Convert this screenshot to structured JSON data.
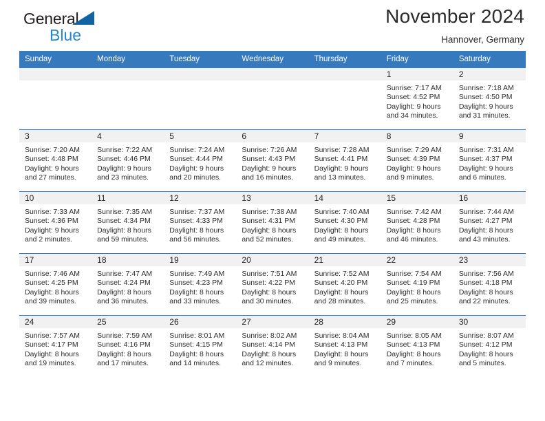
{
  "brand": {
    "name_part1": "General",
    "name_part2": "Blue",
    "triangle_color": "#1263a4",
    "blue_text_color": "#2288d4"
  },
  "header": {
    "title": "November 2024",
    "subtitle": "Hannover, Germany"
  },
  "theme": {
    "header_bg": "#3679bd",
    "daynum_band_bg": "#f1f1f1",
    "row_border": "#3679bd",
    "text": "#2b2b2b"
  },
  "weekdays": [
    "Sunday",
    "Monday",
    "Tuesday",
    "Wednesday",
    "Thursday",
    "Friday",
    "Saturday"
  ],
  "weeks": [
    [
      {
        "day": "",
        "sunrise": "",
        "sunset": "",
        "daylight_line1": "",
        "daylight_line2": ""
      },
      {
        "day": "",
        "sunrise": "",
        "sunset": "",
        "daylight_line1": "",
        "daylight_line2": ""
      },
      {
        "day": "",
        "sunrise": "",
        "sunset": "",
        "daylight_line1": "",
        "daylight_line2": ""
      },
      {
        "day": "",
        "sunrise": "",
        "sunset": "",
        "daylight_line1": "",
        "daylight_line2": ""
      },
      {
        "day": "",
        "sunrise": "",
        "sunset": "",
        "daylight_line1": "",
        "daylight_line2": ""
      },
      {
        "day": "1",
        "sunrise": "Sunrise: 7:17 AM",
        "sunset": "Sunset: 4:52 PM",
        "daylight_line1": "Daylight: 9 hours",
        "daylight_line2": "and 34 minutes."
      },
      {
        "day": "2",
        "sunrise": "Sunrise: 7:18 AM",
        "sunset": "Sunset: 4:50 PM",
        "daylight_line1": "Daylight: 9 hours",
        "daylight_line2": "and 31 minutes."
      }
    ],
    [
      {
        "day": "3",
        "sunrise": "Sunrise: 7:20 AM",
        "sunset": "Sunset: 4:48 PM",
        "daylight_line1": "Daylight: 9 hours",
        "daylight_line2": "and 27 minutes."
      },
      {
        "day": "4",
        "sunrise": "Sunrise: 7:22 AM",
        "sunset": "Sunset: 4:46 PM",
        "daylight_line1": "Daylight: 9 hours",
        "daylight_line2": "and 23 minutes."
      },
      {
        "day": "5",
        "sunrise": "Sunrise: 7:24 AM",
        "sunset": "Sunset: 4:44 PM",
        "daylight_line1": "Daylight: 9 hours",
        "daylight_line2": "and 20 minutes."
      },
      {
        "day": "6",
        "sunrise": "Sunrise: 7:26 AM",
        "sunset": "Sunset: 4:43 PM",
        "daylight_line1": "Daylight: 9 hours",
        "daylight_line2": "and 16 minutes."
      },
      {
        "day": "7",
        "sunrise": "Sunrise: 7:28 AM",
        "sunset": "Sunset: 4:41 PM",
        "daylight_line1": "Daylight: 9 hours",
        "daylight_line2": "and 13 minutes."
      },
      {
        "day": "8",
        "sunrise": "Sunrise: 7:29 AM",
        "sunset": "Sunset: 4:39 PM",
        "daylight_line1": "Daylight: 9 hours",
        "daylight_line2": "and 9 minutes."
      },
      {
        "day": "9",
        "sunrise": "Sunrise: 7:31 AM",
        "sunset": "Sunset: 4:37 PM",
        "daylight_line1": "Daylight: 9 hours",
        "daylight_line2": "and 6 minutes."
      }
    ],
    [
      {
        "day": "10",
        "sunrise": "Sunrise: 7:33 AM",
        "sunset": "Sunset: 4:36 PM",
        "daylight_line1": "Daylight: 9 hours",
        "daylight_line2": "and 2 minutes."
      },
      {
        "day": "11",
        "sunrise": "Sunrise: 7:35 AM",
        "sunset": "Sunset: 4:34 PM",
        "daylight_line1": "Daylight: 8 hours",
        "daylight_line2": "and 59 minutes."
      },
      {
        "day": "12",
        "sunrise": "Sunrise: 7:37 AM",
        "sunset": "Sunset: 4:33 PM",
        "daylight_line1": "Daylight: 8 hours",
        "daylight_line2": "and 56 minutes."
      },
      {
        "day": "13",
        "sunrise": "Sunrise: 7:38 AM",
        "sunset": "Sunset: 4:31 PM",
        "daylight_line1": "Daylight: 8 hours",
        "daylight_line2": "and 52 minutes."
      },
      {
        "day": "14",
        "sunrise": "Sunrise: 7:40 AM",
        "sunset": "Sunset: 4:30 PM",
        "daylight_line1": "Daylight: 8 hours",
        "daylight_line2": "and 49 minutes."
      },
      {
        "day": "15",
        "sunrise": "Sunrise: 7:42 AM",
        "sunset": "Sunset: 4:28 PM",
        "daylight_line1": "Daylight: 8 hours",
        "daylight_line2": "and 46 minutes."
      },
      {
        "day": "16",
        "sunrise": "Sunrise: 7:44 AM",
        "sunset": "Sunset: 4:27 PM",
        "daylight_line1": "Daylight: 8 hours",
        "daylight_line2": "and 43 minutes."
      }
    ],
    [
      {
        "day": "17",
        "sunrise": "Sunrise: 7:46 AM",
        "sunset": "Sunset: 4:25 PM",
        "daylight_line1": "Daylight: 8 hours",
        "daylight_line2": "and 39 minutes."
      },
      {
        "day": "18",
        "sunrise": "Sunrise: 7:47 AM",
        "sunset": "Sunset: 4:24 PM",
        "daylight_line1": "Daylight: 8 hours",
        "daylight_line2": "and 36 minutes."
      },
      {
        "day": "19",
        "sunrise": "Sunrise: 7:49 AM",
        "sunset": "Sunset: 4:23 PM",
        "daylight_line1": "Daylight: 8 hours",
        "daylight_line2": "and 33 minutes."
      },
      {
        "day": "20",
        "sunrise": "Sunrise: 7:51 AM",
        "sunset": "Sunset: 4:22 PM",
        "daylight_line1": "Daylight: 8 hours",
        "daylight_line2": "and 30 minutes."
      },
      {
        "day": "21",
        "sunrise": "Sunrise: 7:52 AM",
        "sunset": "Sunset: 4:20 PM",
        "daylight_line1": "Daylight: 8 hours",
        "daylight_line2": "and 28 minutes."
      },
      {
        "day": "22",
        "sunrise": "Sunrise: 7:54 AM",
        "sunset": "Sunset: 4:19 PM",
        "daylight_line1": "Daylight: 8 hours",
        "daylight_line2": "and 25 minutes."
      },
      {
        "day": "23",
        "sunrise": "Sunrise: 7:56 AM",
        "sunset": "Sunset: 4:18 PM",
        "daylight_line1": "Daylight: 8 hours",
        "daylight_line2": "and 22 minutes."
      }
    ],
    [
      {
        "day": "24",
        "sunrise": "Sunrise: 7:57 AM",
        "sunset": "Sunset: 4:17 PM",
        "daylight_line1": "Daylight: 8 hours",
        "daylight_line2": "and 19 minutes."
      },
      {
        "day": "25",
        "sunrise": "Sunrise: 7:59 AM",
        "sunset": "Sunset: 4:16 PM",
        "daylight_line1": "Daylight: 8 hours",
        "daylight_line2": "and 17 minutes."
      },
      {
        "day": "26",
        "sunrise": "Sunrise: 8:01 AM",
        "sunset": "Sunset: 4:15 PM",
        "daylight_line1": "Daylight: 8 hours",
        "daylight_line2": "and 14 minutes."
      },
      {
        "day": "27",
        "sunrise": "Sunrise: 8:02 AM",
        "sunset": "Sunset: 4:14 PM",
        "daylight_line1": "Daylight: 8 hours",
        "daylight_line2": "and 12 minutes."
      },
      {
        "day": "28",
        "sunrise": "Sunrise: 8:04 AM",
        "sunset": "Sunset: 4:13 PM",
        "daylight_line1": "Daylight: 8 hours",
        "daylight_line2": "and 9 minutes."
      },
      {
        "day": "29",
        "sunrise": "Sunrise: 8:05 AM",
        "sunset": "Sunset: 4:13 PM",
        "daylight_line1": "Daylight: 8 hours",
        "daylight_line2": "and 7 minutes."
      },
      {
        "day": "30",
        "sunrise": "Sunrise: 8:07 AM",
        "sunset": "Sunset: 4:12 PM",
        "daylight_line1": "Daylight: 8 hours",
        "daylight_line2": "and 5 minutes."
      }
    ]
  ]
}
